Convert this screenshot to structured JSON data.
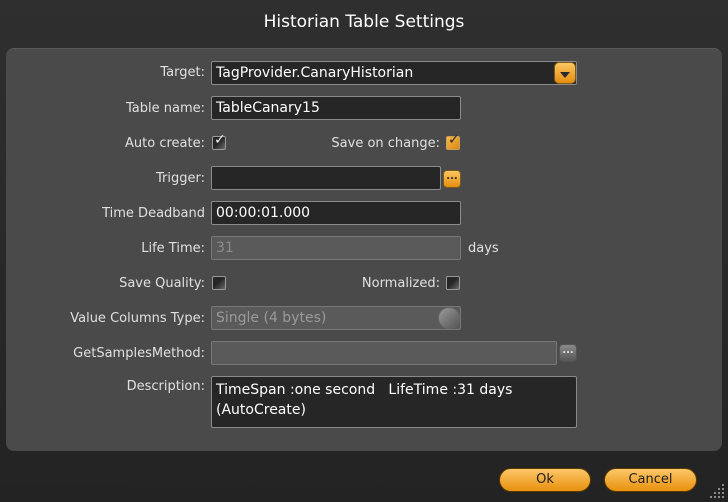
{
  "dialog": {
    "title": "Historian Table Settings"
  },
  "form": {
    "target_label": "Target:",
    "target_value": "TagProvider.CanaryHistorian",
    "table_name_label": "Table name:",
    "table_name_value": "TableCanary15",
    "auto_create_label": "Auto create:",
    "auto_create_checked": true,
    "save_on_change_label": "Save on change:",
    "save_on_change_checked": true,
    "trigger_label": "Trigger:",
    "trigger_value": "",
    "time_deadband_label": "Time Deadband",
    "time_deadband_value": "00:00:01.000",
    "life_time_label": "Life Time:",
    "life_time_value": "31",
    "life_time_unit": "days",
    "save_quality_label": "Save Quality:",
    "save_quality_checked": false,
    "normalized_label": "Normalized:",
    "normalized_checked": false,
    "value_columns_type_label": "Value Columns Type:",
    "value_columns_type_value": "Single (4 bytes)",
    "get_samples_method_label": "GetSamplesMethod:",
    "get_samples_method_value": "",
    "description_label": "Description:",
    "description_value": "TimeSpan :one second   LifeTime :31 days\n(AutoCreate)",
    "ellipsis_text": "..."
  },
  "buttons": {
    "ok_label": "Ok",
    "cancel_label": "Cancel"
  },
  "icons": {
    "dropdown": "chevron-down-icon",
    "checkmark": "check-icon",
    "ellipsis": "ellipsis-icon",
    "resize": "resize-grip-icon"
  },
  "colors": {
    "accent": "#f0a226",
    "panel": "#4a4a4a",
    "field_bg": "#262626"
  }
}
